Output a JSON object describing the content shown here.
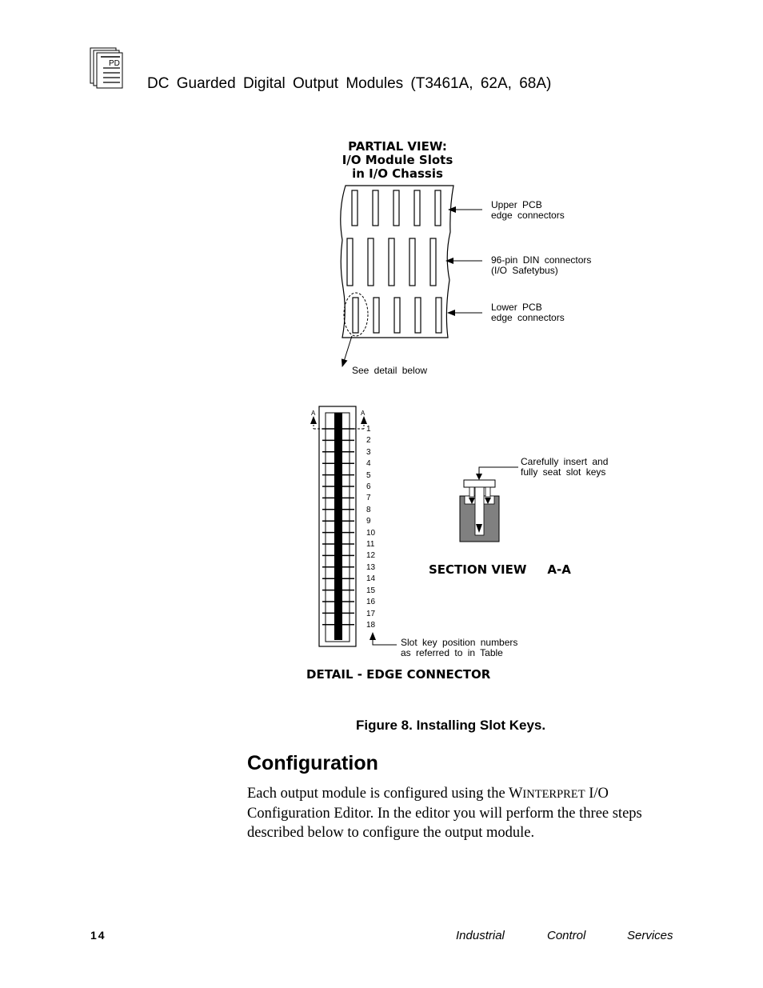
{
  "header": {
    "icon": "document-stack-icon",
    "icon_label": "PD",
    "title": "DC Guarded Digital Output Modules (T3461A, 62A, 68A)"
  },
  "figure": {
    "partial_view": {
      "title_lines": [
        "PARTIAL VIEW:",
        "I/O Module Slots",
        "in I/O Chassis"
      ],
      "callouts": [
        {
          "line1": "Upper PCB",
          "line2": "edge connectors"
        },
        {
          "line1": "96-pin DIN connectors",
          "line2": "(I/O Safetybus)"
        },
        {
          "line1": "Lower PCB",
          "line2": "edge connectors"
        }
      ],
      "detail_pointer": "See detail below"
    },
    "edge_connector": {
      "section_marker": "A",
      "positions": [
        "1",
        "2",
        "3",
        "4",
        "5",
        "6",
        "7",
        "8",
        "9",
        "10",
        "11",
        "12",
        "13",
        "14",
        "15",
        "16",
        "17",
        "18"
      ],
      "callout_line1": "Slot key position numbers",
      "callout_line2": "as referred to in Table",
      "title": "DETAIL - EDGE CONNECTOR"
    },
    "section_view": {
      "callout_line1": "Carefully insert and",
      "callout_line2": "fully seat slot keys",
      "title": "SECTION VIEW",
      "title_suffix": "A-A"
    },
    "caption": "Figure 8.  Installing Slot Keys."
  },
  "section": {
    "heading": "Configuration",
    "para_part1": "Each output module is configured using the W",
    "para_smallcaps": "INTERPRET",
    "para_part2": " I/O Configuration Editor.  In the editor you will perform the three steps described below to configure the output module."
  },
  "footer": {
    "page_number": "14",
    "words": [
      "Industrial",
      "Control",
      "Services"
    ]
  }
}
